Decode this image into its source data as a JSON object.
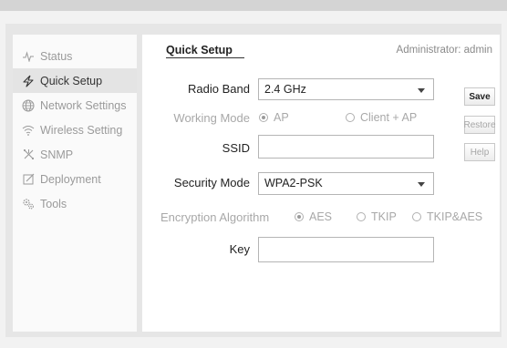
{
  "sidebar": {
    "items": [
      {
        "label": "Status",
        "icon": "pulse-icon",
        "active": false
      },
      {
        "label": "Quick Setup",
        "icon": "lightning-icon",
        "active": true
      },
      {
        "label": "Network Settings",
        "icon": "globe-icon",
        "active": false
      },
      {
        "label": "Wireless Setting",
        "icon": "wifi-icon",
        "active": false
      },
      {
        "label": "SNMP",
        "icon": "snmp-icon",
        "active": false
      },
      {
        "label": "Deployment",
        "icon": "edit-icon",
        "active": false
      },
      {
        "label": "Tools",
        "icon": "gears-icon",
        "active": false
      }
    ]
  },
  "main": {
    "title": "Quick Setup",
    "admin": "Administrator: admin"
  },
  "form": {
    "radio_band": {
      "label": "Radio Band",
      "value": "2.4 GHz"
    },
    "working_mode": {
      "label": "Working Mode",
      "options": [
        "AP",
        "Client + AP"
      ],
      "selected": "AP"
    },
    "ssid": {
      "label": "SSID",
      "value": ""
    },
    "security_mode": {
      "label": "Security Mode",
      "value": "WPA2-PSK"
    },
    "encryption": {
      "label": "Encryption Algorithm",
      "options": [
        "AES",
        "TKIP",
        "TKIP&AES"
      ],
      "selected": "AES"
    },
    "key": {
      "label": "Key",
      "value": ""
    }
  },
  "buttons": {
    "save": "Save",
    "restore": "Restore",
    "help": "Help"
  }
}
